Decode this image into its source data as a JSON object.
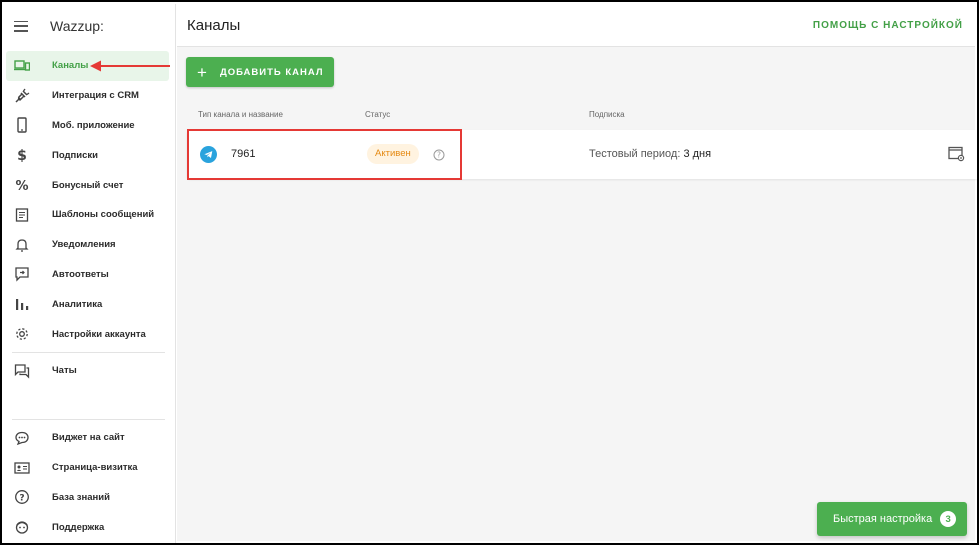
{
  "app": {
    "brand": "Wazzup:"
  },
  "sidebar": {
    "items": [
      {
        "label": "Каналы",
        "icon": "devices-icon",
        "active": true
      },
      {
        "label": "Интеграция с CRM",
        "icon": "plug-icon"
      },
      {
        "label": "Моб. приложение",
        "icon": "smartphone-icon"
      },
      {
        "label": "Подписки",
        "icon": "dollar-icon"
      },
      {
        "label": "Бонусный счет",
        "icon": "percent-icon"
      },
      {
        "label": "Шаблоны сообщений",
        "icon": "document-icon"
      },
      {
        "label": "Уведомления",
        "icon": "bell-icon"
      },
      {
        "label": "Автоответы",
        "icon": "auto-reply-icon"
      },
      {
        "label": "Аналитика",
        "icon": "bar-chart-icon"
      },
      {
        "label": "Настройки аккаунта",
        "icon": "gear-icon"
      },
      {
        "label": "Чаты",
        "icon": "chat-icon"
      }
    ],
    "bottom_items": [
      {
        "label": "Виджет на сайт",
        "icon": "widget-chat-icon"
      },
      {
        "label": "Страница-визитка",
        "icon": "id-card-icon"
      },
      {
        "label": "База знаний",
        "icon": "help-icon"
      },
      {
        "label": "Поддержка",
        "icon": "support-icon"
      }
    ]
  },
  "header": {
    "title": "Каналы",
    "help_link": "ПОМОЩЬ С НАСТРОЙКОЙ"
  },
  "main": {
    "add_button": "ДОБАВИТЬ КАНАЛ",
    "columns": {
      "type_name": "Тип канала и названиe",
      "status": "Статус",
      "subscription": "Подписка"
    },
    "channels": [
      {
        "type": "telegram",
        "name": "7961",
        "status": "Активен",
        "subscription_label": "Тестовый период:",
        "subscription_value": "3 дня"
      }
    ]
  },
  "quick_setup": {
    "label": "Быстрая настройка",
    "count": "3"
  },
  "colors": {
    "accent": "#4caf50",
    "active_bg": "#e8f5e9",
    "badge_bg": "#fff3e0",
    "badge_text": "#e58a13",
    "annotation": "#e53935",
    "telegram": "#2aa3dd"
  }
}
